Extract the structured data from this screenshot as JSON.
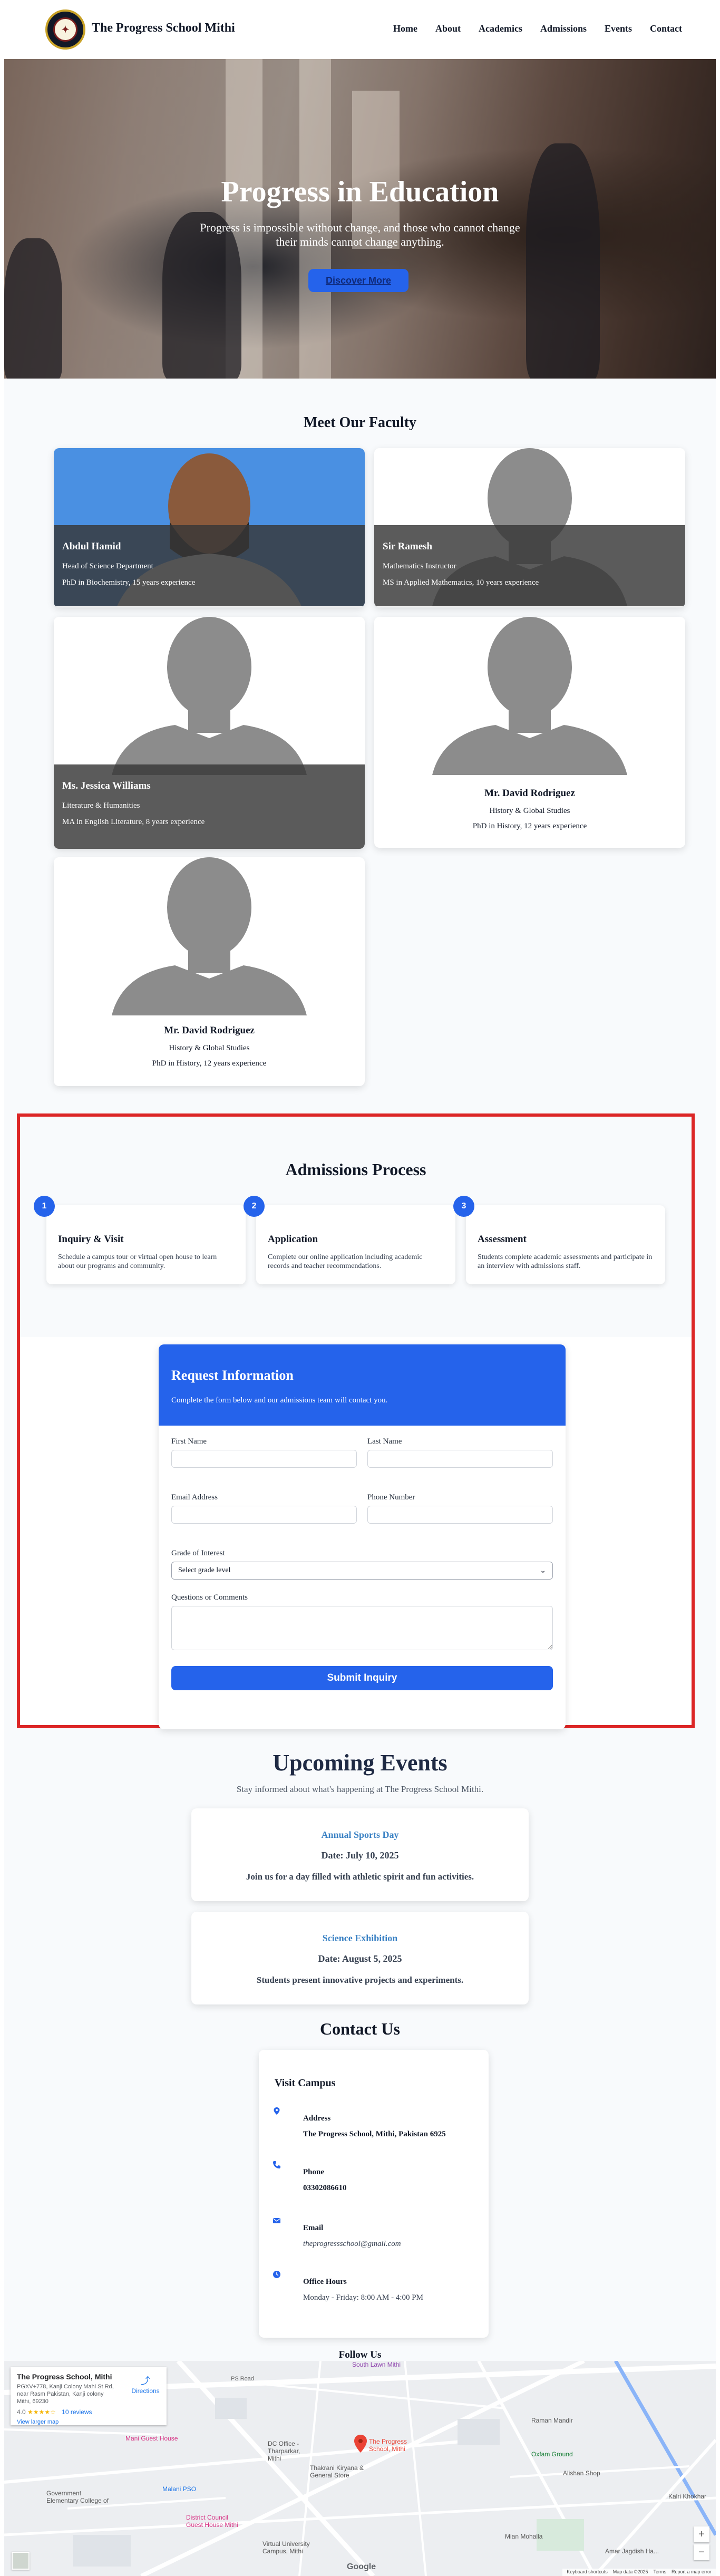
{
  "header": {
    "site_title": "The Progress School Mithi",
    "nav": [
      "Home",
      "About",
      "Academics",
      "Admissions",
      "Events",
      "Contact"
    ]
  },
  "hero": {
    "title": "Progress in Education",
    "subtitle": "Progress is impossible without change, and those who cannot change their minds cannot change anything.",
    "button_label": "Discover More"
  },
  "faculty": {
    "title": "Meet Our Faculty",
    "members": [
      {
        "name": "Abdul Hamid",
        "role": "Head of Science Department",
        "degree": "PhD in Biochemistry, 15 years experience"
      },
      {
        "name": "Sir Ramesh",
        "role": "Mathematics Instructor",
        "degree": "MS in Applied Mathematics, 10 years experience"
      },
      {
        "name": "Ms. Jessica Williams",
        "role": "Literature & Humanities",
        "degree": "MA in English Literature, 8 years experience"
      },
      {
        "name": "Mr. David Rodriguez",
        "role": "History & Global Studies",
        "degree": "PhD in History, 12 years experience"
      },
      {
        "name": "Mr. David Rodriguez",
        "role": "History & Global Studies",
        "degree": "PhD in History, 12 years experience"
      }
    ]
  },
  "admissions": {
    "title": "Admissions Process",
    "steps": [
      {
        "num": "1",
        "title": "Inquiry & Visit",
        "text": "Schedule a campus tour or virtual open house to learn about our programs and community."
      },
      {
        "num": "2",
        "title": "Application",
        "text": "Complete our online application including academic records and teacher recommendations."
      },
      {
        "num": "3",
        "title": "Assessment",
        "text": "Students complete academic assessments and participate in an interview with admissions staff."
      }
    ],
    "form": {
      "title": "Request Information",
      "subtitle": "Complete the form below and our admissions team will contact you.",
      "first_name_label": "First Name",
      "last_name_label": "Last Name",
      "email_label": "Email Address",
      "phone_label": "Phone Number",
      "grade_label": "Grade of Interest",
      "grade_selected": "Select grade level",
      "comments_label": "Questions or Comments",
      "submit_label": "Submit Inquiry"
    }
  },
  "events": {
    "title": "Upcoming Events",
    "subtitle": "Stay informed about what's happening at The Progress School Mithi.",
    "items": [
      {
        "name": "Annual Sports Day",
        "date": "Date: July 10, 2025",
        "desc": "Join us for a day filled with athletic spirit and fun activities."
      },
      {
        "name": "Science Exhibition",
        "date": "Date: August 5, 2025",
        "desc": "Students present innovative projects and experiments."
      }
    ]
  },
  "contact": {
    "title": "Contact Us",
    "card_title": "Visit Campus",
    "items": [
      {
        "icon": "location-pin-icon",
        "label": "Address",
        "value": "The Progress School, Mithi, Pakistan 6925"
      },
      {
        "icon": "phone-icon",
        "label": "Phone",
        "value": "03302086610"
      },
      {
        "icon": "email-icon",
        "label": "Email",
        "value": "theprogressschool@gmail.com"
      },
      {
        "icon": "clock-icon",
        "label": "Office Hours",
        "value": "Monday - Friday: 8:00 AM - 4:00 PM"
      }
    ],
    "follow_label": "Follow Us"
  },
  "map": {
    "place_name": "The Progress School, Mithi",
    "address": "PGXV+778, Kanji Colony Mahi St Rd, near Rasm Pakistan, Kanji colony Mithi, 69230",
    "rating": "4.0",
    "stars": "★★★★☆",
    "reviews": "10 reviews",
    "larger_map": "View larger map",
    "directions": "Directions",
    "labels": {
      "south_lawn": "South Lawn Mithi",
      "mani_guest_house": "Mani Guest House",
      "raman_mandir": "Raman Mandir",
      "dc_office": "DC Office - Tharparkar, Mithi",
      "thakrani": "Thakrani Kiryana & General Store",
      "school_pin": "The Progress School, Mithi",
      "oxfam": "Oxfam Ground",
      "alishan": "Alishan Shop",
      "malani": "Malani PSO",
      "govt_school": "Government Elementary College of",
      "district_guest": "District Council Guest House Mithi",
      "virtual_university": "Virtual University Campus, Mithi",
      "mian": "Mian Mohalla",
      "kalri": "Kalri Khokhar",
      "amar": "Amar Jagdish Ha...",
      "ps_road": "PS Road",
      "google": "Google"
    },
    "footer": [
      "Keyboard shortcuts",
      "Map data ©2025",
      "Terms",
      "Report a map error"
    ],
    "zoom_in": "+",
    "zoom_out": "−"
  },
  "colors": {
    "accent": "#2563eb",
    "highlight_border": "#dc2626",
    "faculty_photo_bg": "#4a90e2"
  }
}
